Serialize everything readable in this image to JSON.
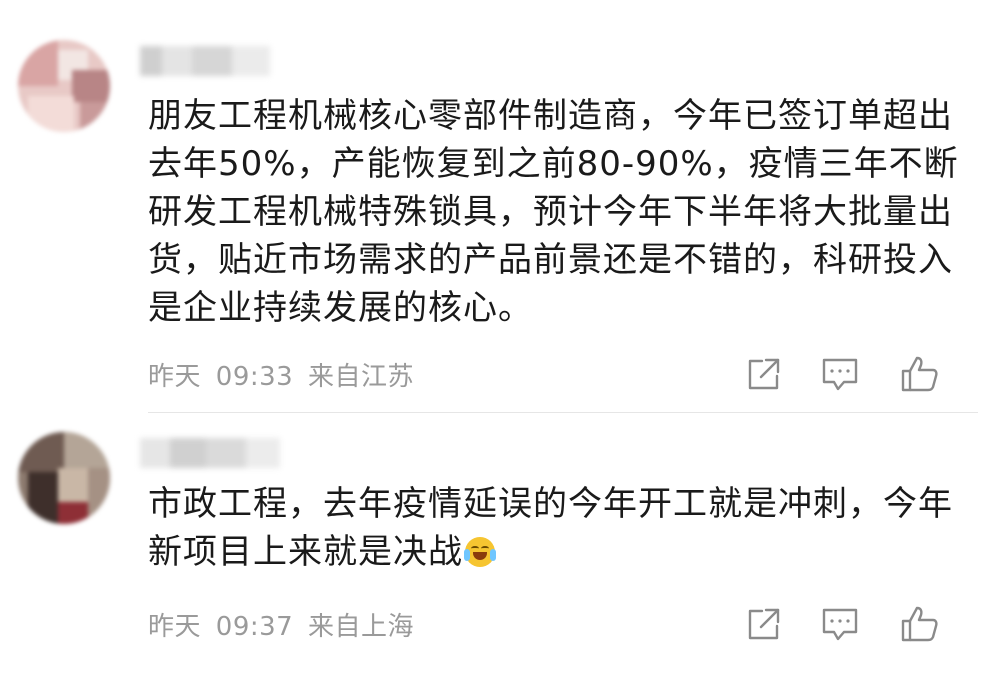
{
  "comments": [
    {
      "text_lines": [
        "朋友工程机械核心零部件制造商，今年已签订单超出",
        "去年50%，产能恢复到之前80-90%，疫情三年不断",
        "研发工程机械特殊锁具，预计今年下半年将大批量出",
        "货，贴近市场需求的产品前景还是不错的，科研投入",
        "是企业持续发展的核心。"
      ],
      "date": "昨天",
      "time": "09:33",
      "location": "来自江苏",
      "actions": [
        "share-icon",
        "comment-icon",
        "like-icon"
      ]
    },
    {
      "text_lines": [
        "市政工程，去年疫情延误的今年开工就是冲刺，今年",
        "新项目上来就是决战"
      ],
      "emoji": "crying-laughing-emoji",
      "date": "昨天",
      "time": "09:37",
      "location": "来自上海",
      "actions": [
        "share-icon",
        "comment-icon",
        "like-icon"
      ]
    }
  ],
  "colors": {
    "text": "#1a1a1a",
    "meta": "#9a9a9a",
    "icon": "#8a8a8a",
    "divider": "#e6e6e6"
  }
}
